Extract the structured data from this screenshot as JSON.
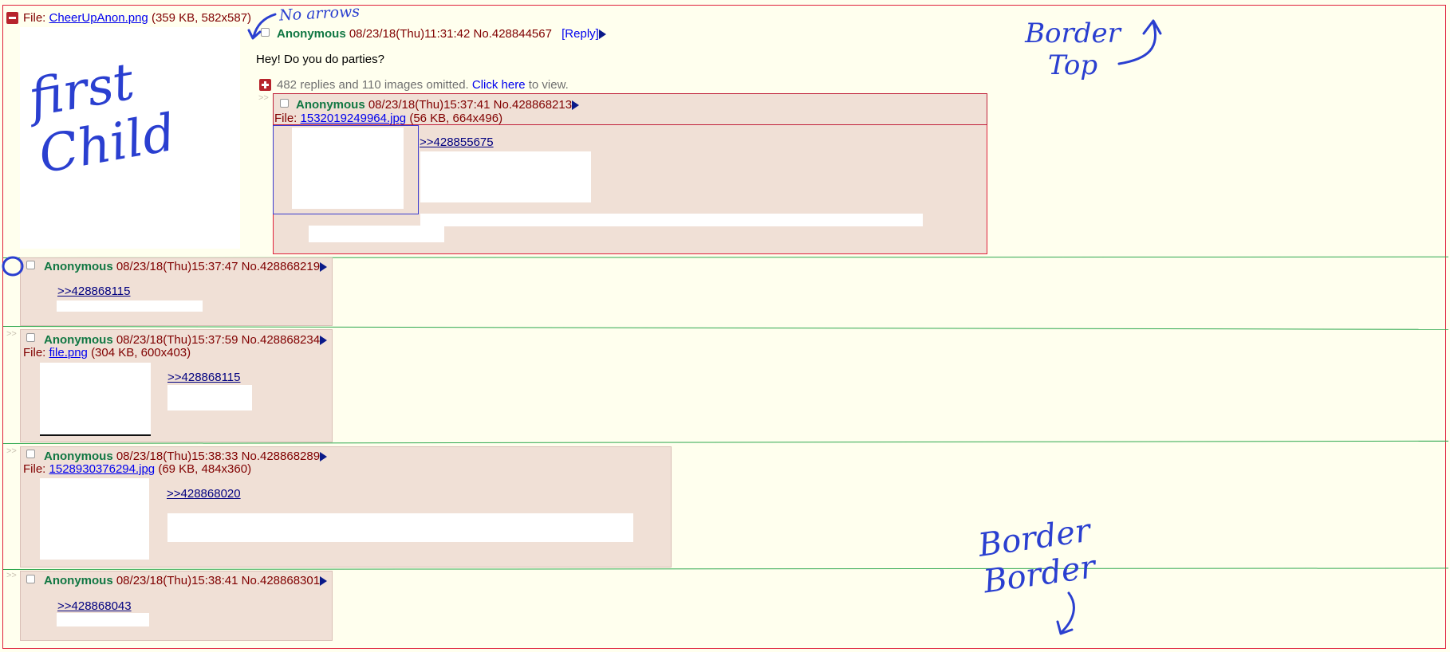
{
  "op": {
    "file_prefix": "File:",
    "file_name": "CheerUpAnon.png",
    "file_info": "(359 KB, 582x587)",
    "name": "Anonymous",
    "datetime": "08/23/18(Thu)11:31:42",
    "post_no": "No.428844567",
    "reply_link": "[Reply]",
    "comment": "Hey! Do you do parties?",
    "omitted_text": "482 replies and 110 images omitted.",
    "click_here": "Click here",
    "to_view": "to view."
  },
  "replies": [
    {
      "name": "Anonymous",
      "datetime": "08/23/18(Thu)15:37:41",
      "post_no": "No.428868213",
      "file_prefix": "File:",
      "file_name": "1532019249964.jpg",
      "file_info": "(56 KB, 664x496)",
      "quote": ">>428855675"
    },
    {
      "name": "Anonymous",
      "datetime": "08/23/18(Thu)15:37:47",
      "post_no": "No.428868219",
      "quote": ">>428868115"
    },
    {
      "name": "Anonymous",
      "datetime": "08/23/18(Thu)15:37:59",
      "post_no": "No.428868234",
      "file_prefix": "File:",
      "file_name": "file.png",
      "file_info": "(304 KB, 600x403)",
      "quote": ">>428868115"
    },
    {
      "name": "Anonymous",
      "datetime": "08/23/18(Thu)15:38:33",
      "post_no": "No.428868289",
      "file_prefix": "File:",
      "file_name": "1528930376294.jpg",
      "file_info": "(69 KB, 484x360)",
      "quote": ">>428868020"
    },
    {
      "name": "Anonymous",
      "datetime": "08/23/18(Thu)15:38:41",
      "post_no": "No.428868301",
      "quote": ">>428868043"
    }
  ],
  "side_arrow": ">>",
  "annotations": {
    "no_arrows": "No arrows",
    "first_child": "first Child",
    "border_top": "Border Top",
    "border_border": "Border Border"
  },
  "colors": {
    "background": "#ffffee",
    "reply_bg": "#f0e0d6",
    "name": "#117743",
    "text": "#800000",
    "link": "#0000ee",
    "quote_link": "#000080",
    "annotation_ink": "#2a3fd0",
    "outline_red": "#e0203a",
    "divider_green": "#2fa84f"
  },
  "icons": {
    "hide_thread": "minus-box-icon",
    "expand": "plus-box-icon",
    "menu": "triangle-right-icon"
  }
}
